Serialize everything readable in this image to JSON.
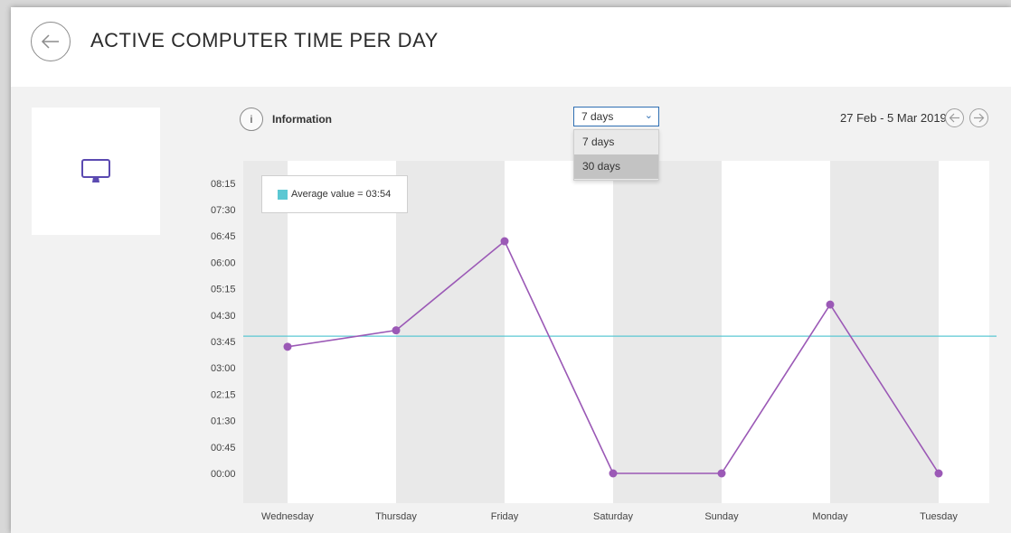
{
  "header": {
    "title": "ACTIVE COMPUTER TIME PER DAY",
    "back_icon": "arrow-left-icon"
  },
  "tile": {
    "icon": "monitor-icon"
  },
  "info": {
    "icon_glyph": "i",
    "label": "Information"
  },
  "range_select": {
    "value": "7 days",
    "options": [
      {
        "label": "7 days"
      },
      {
        "label": "30 days"
      }
    ]
  },
  "date_range": {
    "text": "27 Feb - 5 Mar 2019"
  },
  "colors": {
    "series": "#9b59b6",
    "average": "#5bc8d3",
    "band": "#e9e9e9",
    "accent": "#2f6fb3",
    "icon": "#5b4ab1"
  },
  "chart_data": {
    "type": "line",
    "categories": [
      "Wednesday",
      "Thursday",
      "Friday",
      "Saturday",
      "Sunday",
      "Monday",
      "Tuesday"
    ],
    "y_ticks": [
      "00:00",
      "00:45",
      "01:30",
      "02:15",
      "03:00",
      "03:45",
      "04:30",
      "05:15",
      "06:00",
      "06:45",
      "07:30",
      "08:15"
    ],
    "ylim_minutes": [
      0,
      495
    ],
    "series": [
      {
        "values_minutes": [
          216,
          244,
          396,
          0,
          0,
          288,
          0
        ]
      }
    ],
    "average": {
      "label": "Average value = 03:54",
      "value_minutes": 234
    }
  }
}
